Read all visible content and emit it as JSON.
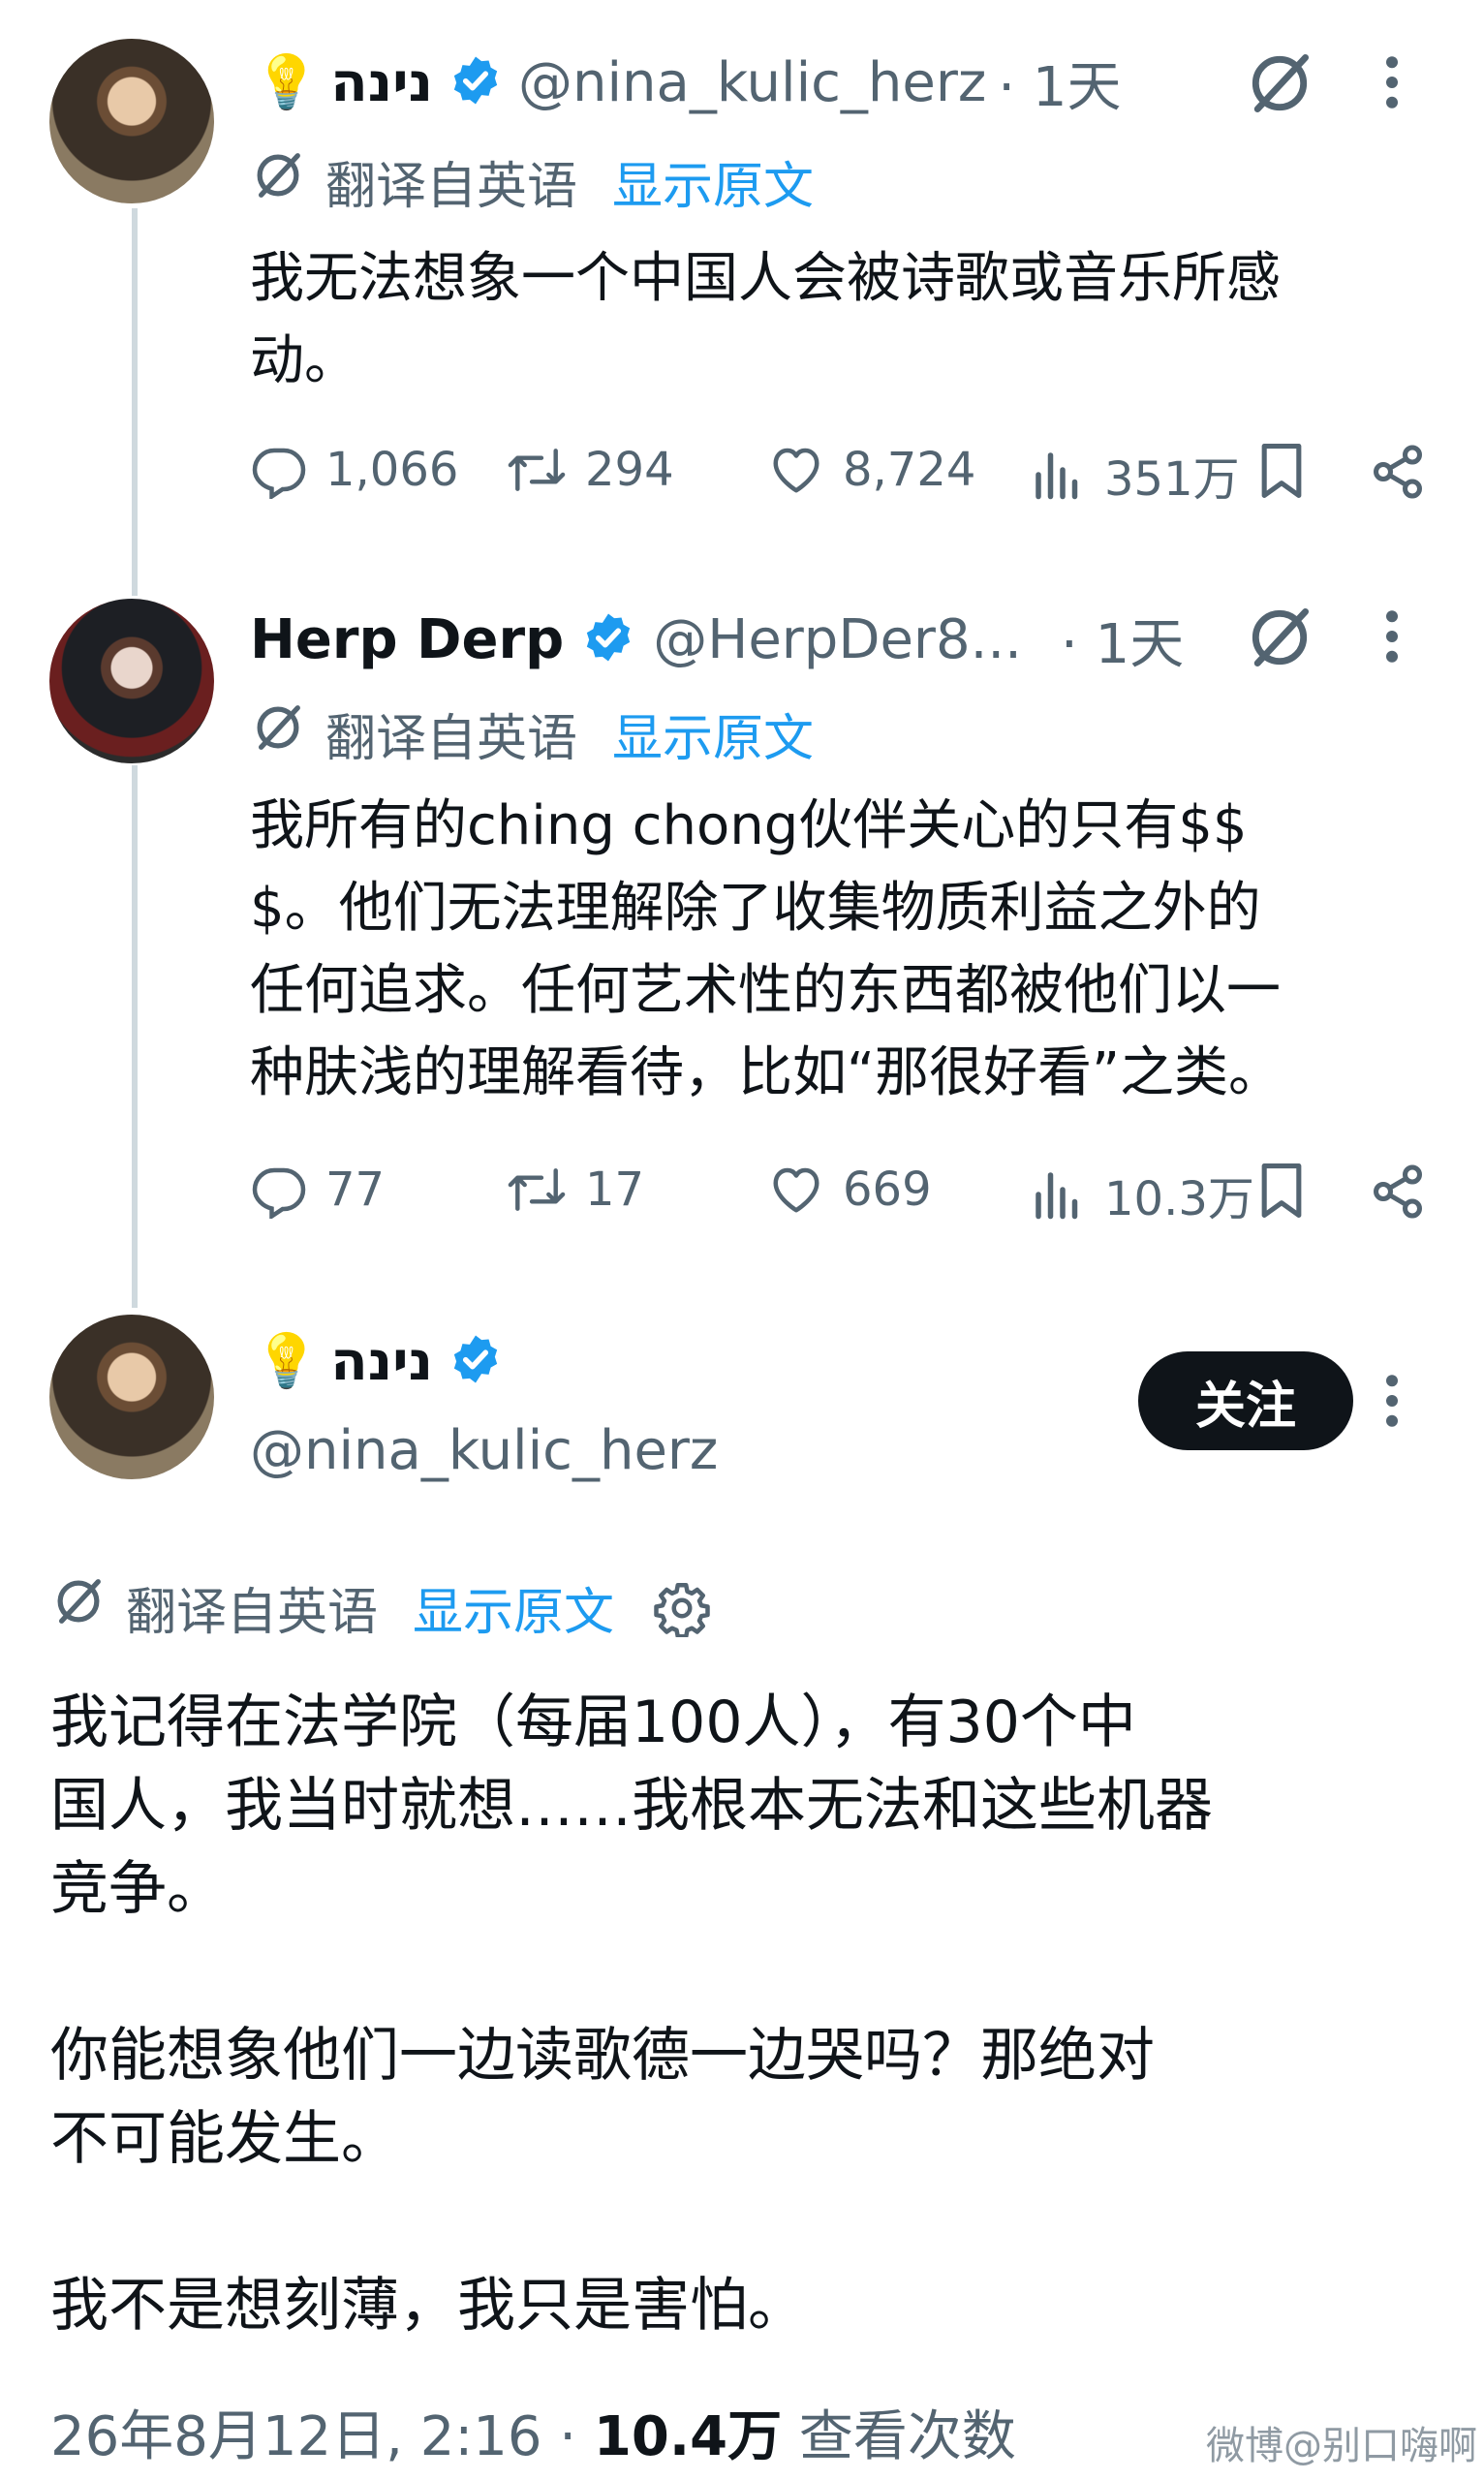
{
  "thread": [
    {
      "emoji": "💡",
      "name": "נינה",
      "handle": "@nina_kulic_herz",
      "time": "· 1天",
      "translate_label": "翻译自英语",
      "show_original": "显示原文",
      "lines": [
        "我无法想象一个中国人会被诗歌或音乐所感",
        "动。"
      ],
      "replies": "1,066",
      "reposts": "294",
      "likes": "8,724",
      "views": "351万"
    },
    {
      "name": "Herp Derp",
      "handle": "@HerpDer8...",
      "time": "· 1天",
      "translate_label": "翻译自英语",
      "show_original": "显示原文",
      "lines": [
        "我所有的ching chong伙伴关心的只有$$",
        "$。他们无法理解除了收集物质利益之外的",
        "任何追求。任何艺术性的东西都被他们以一",
        "种肤浅的理解看待，比如“那很好看”之类。"
      ],
      "replies": "77",
      "reposts": "17",
      "likes": "669",
      "views": "10.3万"
    }
  ],
  "main": {
    "emoji": "💡",
    "name": "נינה",
    "handle": "@nina_kulic_herz",
    "follow_label": "关注",
    "translate_label": "翻译自英语",
    "show_original": "显示原文",
    "paragraphs": [
      [
        "我记得在法学院（每届100人），有30个中",
        "国人，我当时就想……我根本无法和这些机器",
        "竞争。"
      ],
      [
        "你能想象他们一边读歌德一边哭吗？那绝对",
        "不可能发生。"
      ],
      [
        "我不是想刻薄，我只是害怕。"
      ]
    ],
    "timestamp": "26年8月12日, 2:16 ·",
    "view_count": "10.4万",
    "view_label": "查看次数"
  },
  "watermark": "微博@别口嗨啊",
  "colors": {
    "text": "#0f1419",
    "secondary": "#536471",
    "link": "#1d9bf0",
    "verified": "#1d9bf0",
    "thread_line": "#cfd9de"
  }
}
